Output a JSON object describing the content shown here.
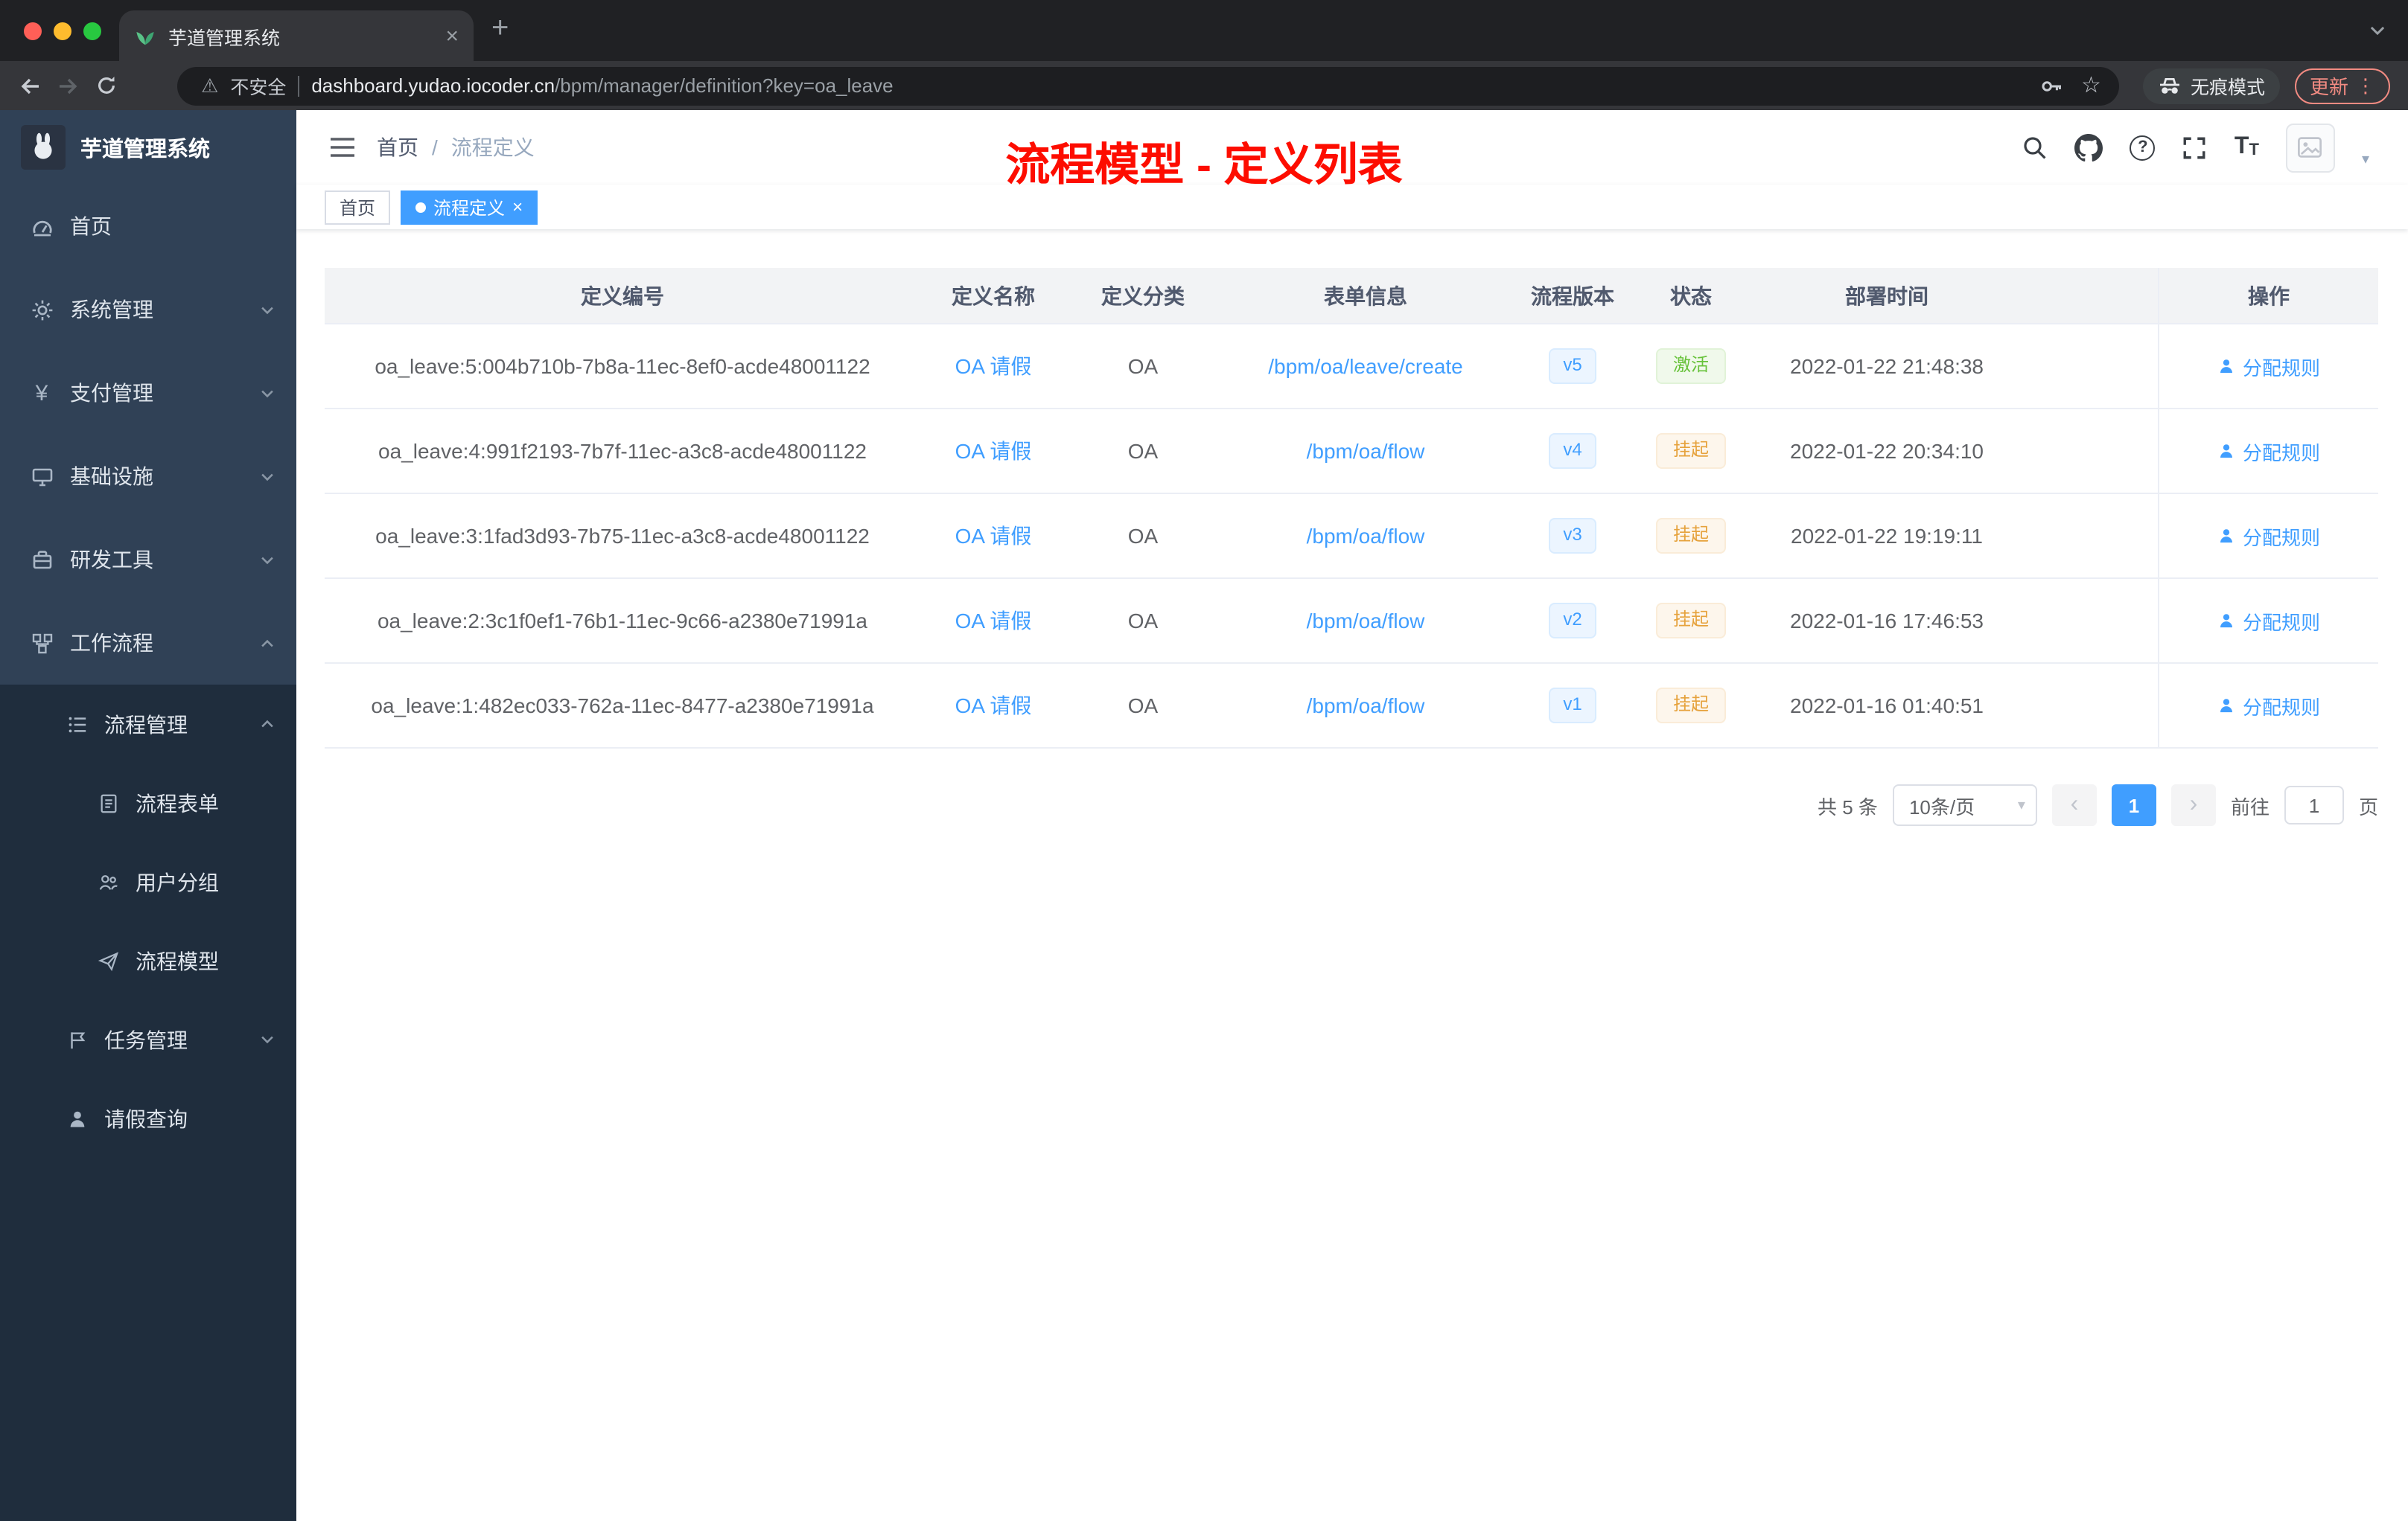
{
  "colors": {
    "accent": "#409eff",
    "success": "#67c23a",
    "success-bg": "#f0f9eb",
    "success-border": "#e1f3d8",
    "warning": "#e6a23c",
    "warning-bg": "#fdf6ec",
    "warning-border": "#faecd8",
    "annotation": "#fd0d00",
    "sidebar": "#304156",
    "sidebar-dark": "#1f2d3d"
  },
  "browser": {
    "tab_title": "芋道管理系统",
    "security_label": "不安全",
    "url_domain": "dashboard.yudao.iocoder.cn",
    "url_path": "/bpm/manager/definition?key=oa_leave",
    "incognito_label": "无痕模式",
    "update_label": "更新"
  },
  "icons": {
    "close": "×",
    "plus": "+",
    "star": "☆",
    "warning": "⚠",
    "dots": "⋮",
    "caret_down": "▾",
    "prev": "‹",
    "next": "›",
    "question": "?"
  },
  "sidebar": {
    "logo_title": "芋道管理系统",
    "items": [
      {
        "label": "首页"
      },
      {
        "label": "系统管理"
      },
      {
        "label": "支付管理"
      },
      {
        "label": "基础设施"
      },
      {
        "label": "研发工具"
      },
      {
        "label": "工作流程"
      },
      {
        "label": "流程管理"
      },
      {
        "label": "流程表单"
      },
      {
        "label": "用户分组"
      },
      {
        "label": "流程模型"
      },
      {
        "label": "任务管理"
      },
      {
        "label": "请假查询"
      }
    ]
  },
  "navbar": {
    "breadcrumb_home": "首页",
    "breadcrumb_sep": "/",
    "breadcrumb_current": "流程定义",
    "annotation": "流程模型 - 定义列表"
  },
  "tags": {
    "home": "首页",
    "active": "流程定义"
  },
  "table": {
    "headers": [
      "定义编号",
      "定义名称",
      "定义分类",
      "表单信息",
      "流程版本",
      "状态",
      "部署时间",
      "操作"
    ],
    "rows": [
      {
        "id": "oa_leave:5:004b710b-7b8a-11ec-8ef0-acde48001122",
        "name": "OA 请假",
        "category": "OA",
        "form": "/bpm/oa/leave/create",
        "version": "v5",
        "status": "激活",
        "status_type": "success",
        "deploy_time": "2022-01-22 21:48:38",
        "action": "分配规则"
      },
      {
        "id": "oa_leave:4:991f2193-7b7f-11ec-a3c8-acde48001122",
        "name": "OA 请假",
        "category": "OA",
        "form": "/bpm/oa/flow",
        "version": "v4",
        "status": "挂起",
        "status_type": "warning",
        "deploy_time": "2022-01-22 20:34:10",
        "action": "分配规则"
      },
      {
        "id": "oa_leave:3:1fad3d93-7b75-11ec-a3c8-acde48001122",
        "name": "OA 请假",
        "category": "OA",
        "form": "/bpm/oa/flow",
        "version": "v3",
        "status": "挂起",
        "status_type": "warning",
        "deploy_time": "2022-01-22 19:19:11",
        "action": "分配规则"
      },
      {
        "id": "oa_leave:2:3c1f0ef1-76b1-11ec-9c66-a2380e71991a",
        "name": "OA 请假",
        "category": "OA",
        "form": "/bpm/oa/flow",
        "version": "v2",
        "status": "挂起",
        "status_type": "warning",
        "deploy_time": "2022-01-16 17:46:53",
        "action": "分配规则"
      },
      {
        "id": "oa_leave:1:482ec033-762a-11ec-8477-a2380e71991a",
        "name": "OA 请假",
        "category": "OA",
        "form": "/bpm/oa/flow",
        "version": "v1",
        "status": "挂起",
        "status_type": "warning",
        "deploy_time": "2022-01-16 01:40:51",
        "action": "分配规则"
      }
    ]
  },
  "pagination": {
    "total": "共 5 条",
    "page_size": "10条/页",
    "current_page": "1",
    "goto_label": "前往",
    "goto_value": "1",
    "page_unit": "页"
  }
}
